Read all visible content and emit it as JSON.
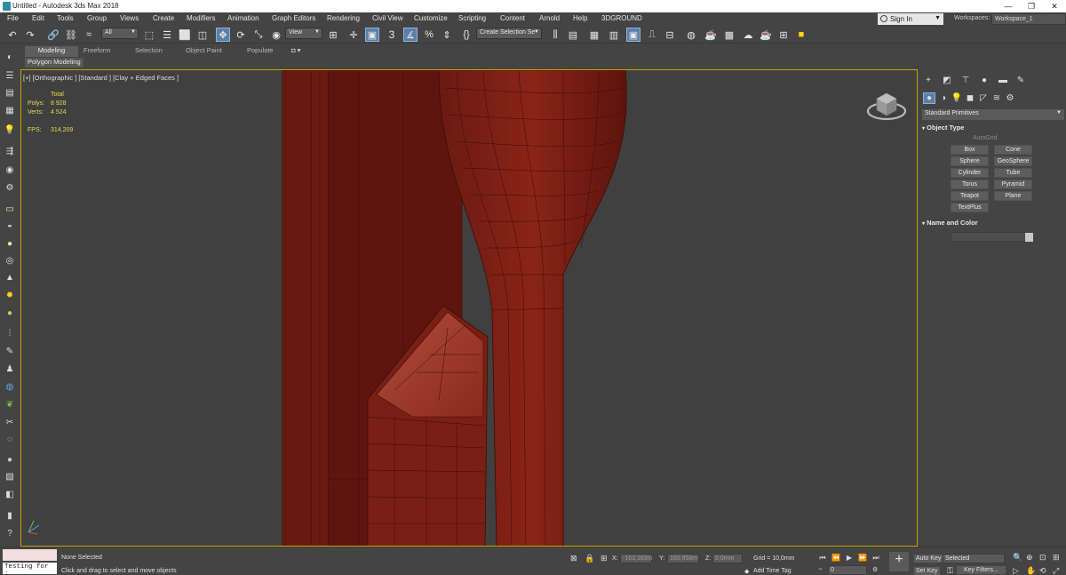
{
  "window": {
    "title": "Untitled - Autodesk 3ds Max 2018",
    "minimize": "—",
    "maximize": "❐",
    "close": "✕"
  },
  "menu": [
    "File",
    "Edit",
    "Tools",
    "Group",
    "Views",
    "Create",
    "Modifiers",
    "Animation",
    "Graph Editors",
    "Rendering",
    "Civil View",
    "Customize",
    "Scripting",
    "Content",
    "Arnold",
    "Help",
    "3DGROUND"
  ],
  "account": {
    "signin": "Sign In",
    "workspaces_label": "Workspaces:",
    "workspace": "Workspace_1"
  },
  "toolbar": {
    "filter": "All",
    "ref_coord": "View",
    "selection_set": "Create Selection Se",
    "snap_value": "3"
  },
  "ribbon": {
    "tabs": [
      "Modeling",
      "Freeform",
      "Selection",
      "Object Paint",
      "Populate"
    ],
    "panel": "Polygon Modeling"
  },
  "viewport": {
    "label": "[+] [Orthographic ] [Standard ] [Clay + Edged Faces ]",
    "stats": {
      "total_label": "Total",
      "polys_label": "Polys:",
      "polys": "8 928",
      "verts_label": "Verts:",
      "verts": "4 524",
      "fps_label": "FPS:",
      "fps": "314,209"
    },
    "object_color": "#7a1f15"
  },
  "command_panel": {
    "category": "Standard Primitives",
    "object_type_title": "Object Type",
    "autogrid": "AutoGrid",
    "buttons": [
      "Box",
      "Cone",
      "Sphere",
      "GeoSphere",
      "Cylinder",
      "Tube",
      "Torus",
      "Pyramid",
      "Teapot",
      "Plane",
      "TextPlus"
    ],
    "name_color_title": "Name and Color"
  },
  "status": {
    "maxscript_output": "Testing for :",
    "selection": "None Selected",
    "prompt": "Click and drag to select and move objects",
    "x_label": "X:",
    "x": "-163,183m",
    "y_label": "Y:",
    "y": "160,958m",
    "z_label": "Z:",
    "z": "0,0mm",
    "grid": "Grid = 10,0mm",
    "add_time_tag": "Add Time Tag",
    "frame": "0",
    "auto_key": "Auto Key",
    "set_key": "Set Key",
    "key_mode": "Selected",
    "key_filters": "Key Filters..."
  }
}
